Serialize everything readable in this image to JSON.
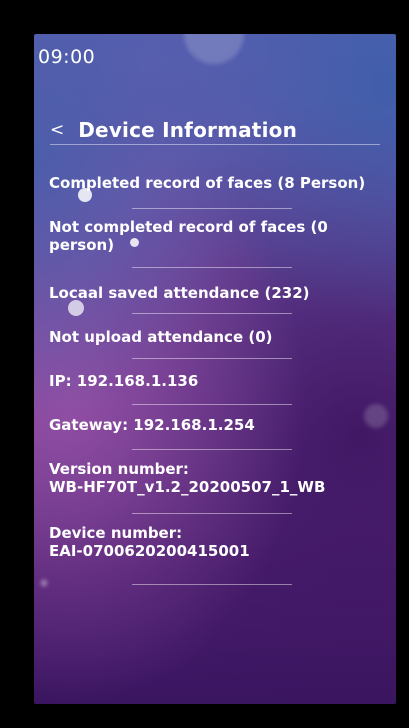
{
  "status_bar": {
    "time": "09:00"
  },
  "header": {
    "back_symbol": "<",
    "title": "Device Information"
  },
  "info_items": [
    {
      "line1": "Completed record of faces (8 Person)",
      "line2": ""
    },
    {
      "line1": "Not completed record of faces (0",
      "line2": "person)"
    },
    {
      "line1": "Locaal saved attendance (232)",
      "line2": ""
    },
    {
      "line1": "Not upload attendance (0)",
      "line2": ""
    },
    {
      "line1": "IP: 192.168.1.136",
      "line2": ""
    },
    {
      "line1": "Gateway: 192.168.1.254",
      "line2": ""
    },
    {
      "line1": "Version number:",
      "line2": "WB-HF70T_v1.2_20200507_1_WB"
    },
    {
      "line1": "Device number:",
      "line2": "EAI-0700620200415001"
    }
  ],
  "colors": {
    "text": "#ffffff",
    "background_frame": "#000000",
    "gradient_top": "#5b5fb0",
    "gradient_bottom": "#3a1560"
  },
  "icons": {
    "back": "chevron-left-icon"
  }
}
